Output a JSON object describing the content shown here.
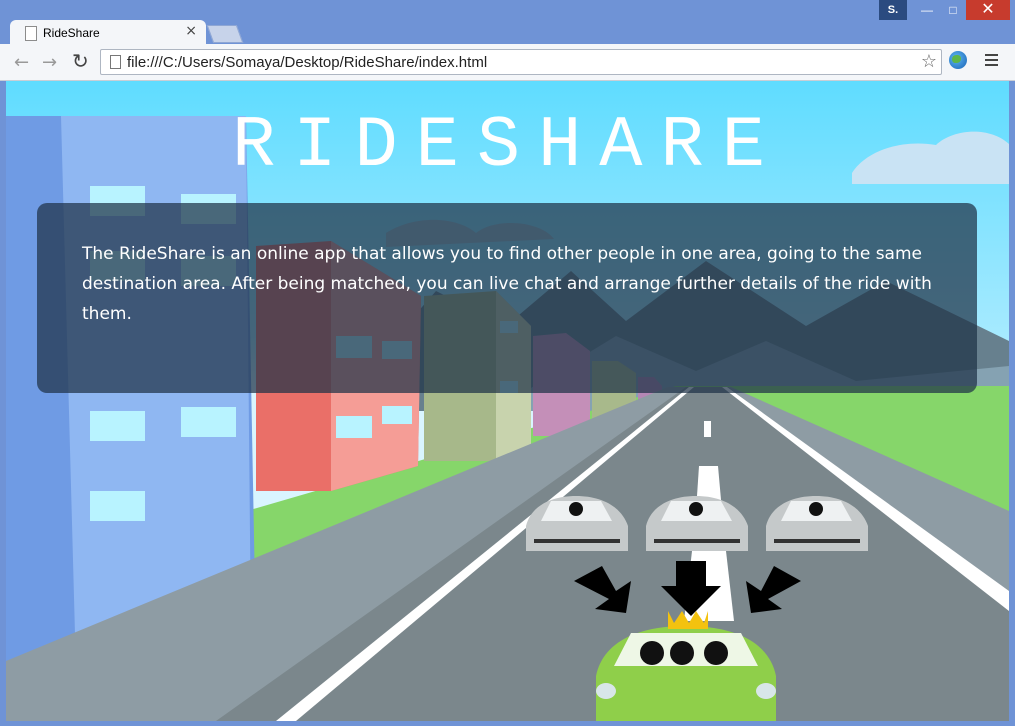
{
  "browser": {
    "tab_title": "RideShare",
    "tab_close": "×",
    "user_badge": "S.",
    "url": "file:///C:/Users/Somaya/Desktop/RideShare/index.html"
  },
  "page": {
    "brand_title": "RIDESHARE",
    "description": "The RideShare is an online app that allows you to find other people in one area, going to the same destination area. After being matched, you can live chat and arrange further details of the ride with them."
  },
  "icons": {
    "back": "back-arrow-icon",
    "forward": "forward-arrow-icon",
    "reload": "reload-icon",
    "page": "document-icon",
    "bookmark": "star-icon",
    "extension": "globe-icon",
    "menu": "hamburger-menu-icon"
  },
  "colors": {
    "titlebar": "#6f93d6",
    "close_button": "#c73b2d",
    "panel": "rgba(30,50,70,0.72)",
    "car_highlight": "#8fcf4a"
  }
}
